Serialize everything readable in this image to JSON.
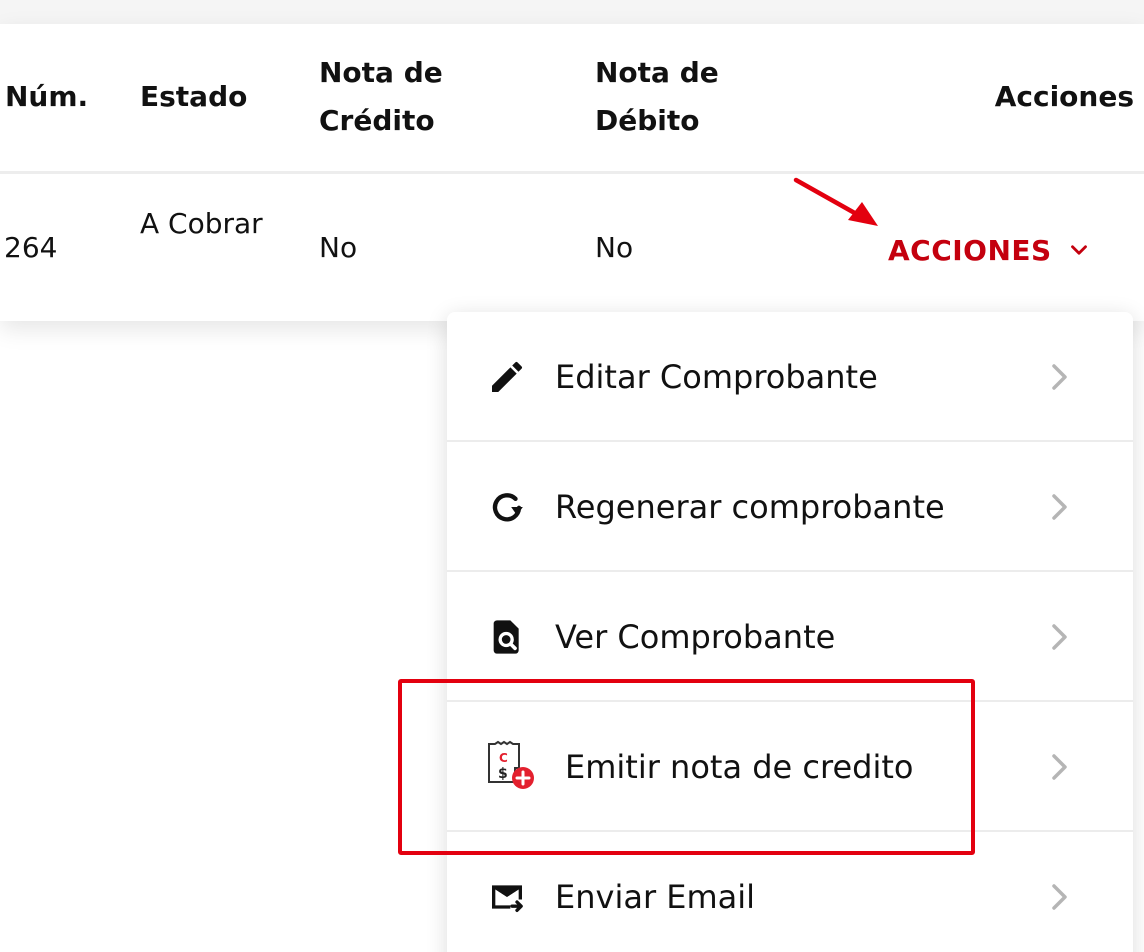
{
  "table": {
    "headers": {
      "num": "Núm.",
      "estado": "Estado",
      "nota_credito": "Nota de Crédito",
      "nota_debito": "Nota de Débito",
      "acciones": "Acciones"
    },
    "rows": [
      {
        "num": "264",
        "estado": "A Cobrar",
        "nota_credito": "No",
        "nota_debito": "No",
        "acciones_label": "ACCIONES"
      }
    ]
  },
  "menu": {
    "items": [
      {
        "label": "Editar Comprobante",
        "icon": "pencil-icon"
      },
      {
        "label": "Regenerar comprobante",
        "icon": "refresh-icon"
      },
      {
        "label": "Ver Comprobante",
        "icon": "document-search-icon"
      },
      {
        "label": "Emitir nota de credito",
        "icon": "credit-note-add-icon"
      },
      {
        "label": "Enviar Email",
        "icon": "email-send-icon"
      }
    ]
  },
  "colors": {
    "accent_red": "#c4000e",
    "highlight_red": "#e3000f",
    "credit_icon_red": "#e3202e",
    "text": "#111111",
    "chevron_gray": "#b5b5b5",
    "divider": "#ececec"
  }
}
